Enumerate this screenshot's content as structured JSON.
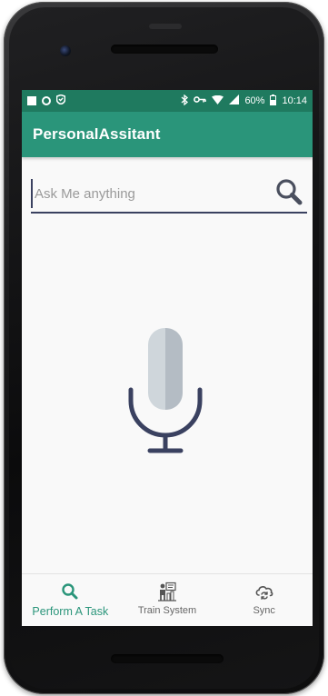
{
  "status_bar": {
    "battery": "60%",
    "time": "10:14"
  },
  "app": {
    "title": "PersonalAssitant"
  },
  "search": {
    "placeholder": "Ask Me anything",
    "value": ""
  },
  "bottom_nav": {
    "items": [
      {
        "label": "Perform A Task",
        "icon": "search-icon",
        "active": true
      },
      {
        "label": "Train System",
        "icon": "train-system-icon",
        "active": false
      },
      {
        "label": "Sync",
        "icon": "sync-icon",
        "active": false
      }
    ]
  },
  "colors": {
    "status_bar": "#1f7a5f",
    "app_bar": "#2a957a",
    "accent": "#2a957a",
    "mic_body_left": "#cfd6db",
    "mic_body_right": "#b4bcc4",
    "mic_stand": "#3a4160"
  }
}
